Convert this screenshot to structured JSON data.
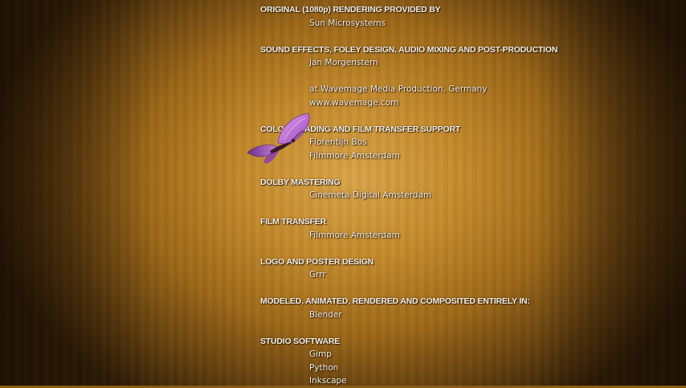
{
  "credits": [
    {
      "heading": "ORIGINAL (1080p) RENDERING PROVIDED BY",
      "names": [
        "Sun Microsystems"
      ]
    },
    {
      "heading": "SOUND EFFECTS, FOLEY DESIGN, AUDIO MIXING AND POST-PRODUCTION",
      "names": [
        "Jan Morgenstern",
        "",
        "at Wavemage Media Production, Germany",
        "www.wavemage.com"
      ]
    },
    {
      "heading": "COLOR GRADING AND FILM TRANSFER SUPPORT",
      "names": [
        "Florentijn Bos",
        "Filmmore Amsterdam"
      ]
    },
    {
      "heading": "DOLBY MASTERING",
      "names": [
        "Cinemeta Digital Amsterdam"
      ]
    },
    {
      "heading": "FILM TRANSFER",
      "names": [
        "Filmmore Amsterdam"
      ]
    },
    {
      "heading": "LOGO AND POSTER DESIGN",
      "names": [
        "Grrr"
      ]
    },
    {
      "heading": "MODELED, ANIMATED, RENDERED AND COMPOSITED ENTIRELY IN:",
      "names": [
        "Blender"
      ]
    },
    {
      "heading": "STUDIO SOFTWARE",
      "names": [
        "Gimp",
        "Python",
        "Inkscape"
      ]
    }
  ],
  "colors": {
    "text": "#f4efe6",
    "butterfly": "#c27ad8",
    "background_center": "#d9a448",
    "background_edge": "#2e1c06"
  },
  "icons": {
    "butterfly": "butterfly-icon"
  }
}
